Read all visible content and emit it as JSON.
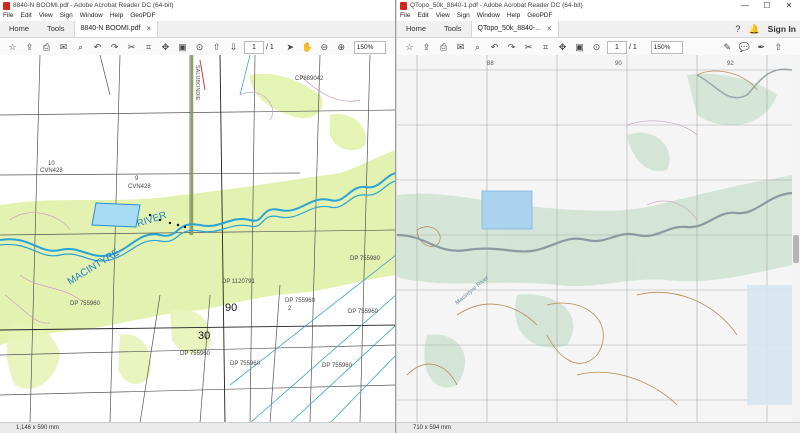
{
  "left": {
    "title": "8840-N BOOMI.pdf - Adobe Acrobat Reader DC (64-bit)",
    "menu": [
      "File",
      "Edit",
      "View",
      "Sign",
      "Window",
      "Help",
      "GeoPDF"
    ],
    "tabs": {
      "home": "Home",
      "tools": "Tools",
      "doc": "8840-N BOOMI.pdf"
    },
    "page": "1",
    "page_total": "/ 1",
    "zoom": "150%",
    "status": "1,146 x 590 mm",
    "map": {
      "parcels": [
        "10",
        "CVN428",
        "9",
        "CVN428",
        "CP889042",
        "DP 755980",
        "DP 755960",
        "2",
        "DP 755960",
        "DP 755960",
        "DP 1120791",
        "DP 755960",
        "DP 755960",
        "DP 755960"
      ],
      "river_a": "MACINTYRE",
      "river_b": "RIVER",
      "grid_90": "90",
      "grid_30": "30",
      "road": "SALUBONDIE"
    }
  },
  "right": {
    "title": "QTopo_50k_8840-1.pdf - Adobe Acrobat Reader DC (64-bit)",
    "menu": [
      "File",
      "Edit",
      "View",
      "Sign",
      "Window",
      "Help",
      "GeoPDF"
    ],
    "tabs": {
      "home": "Home",
      "tools": "Tools",
      "doc": "QTopo_50k_8840-..."
    },
    "sign_in": "Sign In",
    "page": "1",
    "page_total": "/ 1",
    "zoom": "150%",
    "status": "710 x 594 mm",
    "map": {
      "grid_88": "88",
      "grid_90": "90",
      "grid_92": "92",
      "river": "Macintyre River"
    }
  },
  "colors": {
    "river": "#2aa3d6",
    "veg": "#d9ef9a",
    "topo_river": "#8a9aa0",
    "acrobat_red": "#d4271b",
    "accent": "#1473e6"
  }
}
